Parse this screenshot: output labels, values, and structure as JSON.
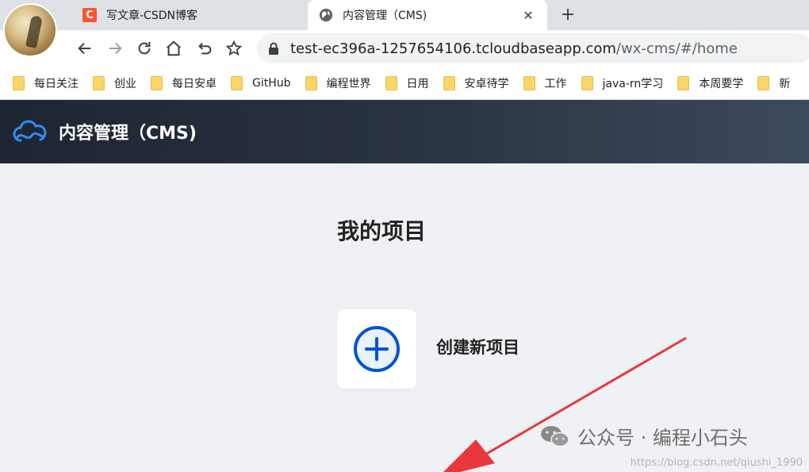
{
  "browser": {
    "tabs": [
      {
        "title": "写文章-CSDN博客",
        "favicon": "C"
      },
      {
        "title": "内容管理（CMS)",
        "close": "✕"
      }
    ],
    "new_tab": "+",
    "url_host": "test-ec396a-1257654106.tcloudbaseapp.com",
    "url_path": "/wx-cms/#/home",
    "bookmarks": [
      "每日关注",
      "创业",
      "每日安卓",
      "GitHub",
      "编程世界",
      "日用",
      "安卓待学",
      "工作",
      "java-rn学习",
      "本周要学",
      "新"
    ]
  },
  "app": {
    "title": "内容管理（CMS)",
    "section_title": "我的项目",
    "create_label": "创建新项目"
  },
  "watermark": {
    "text": "公众号 · 编程小石头",
    "url": "https://blog.csdn.net/qiushi_1990"
  },
  "colors": {
    "accent": "#0052d9",
    "arrow": "#e8383b",
    "header_bg": "#232b38"
  }
}
